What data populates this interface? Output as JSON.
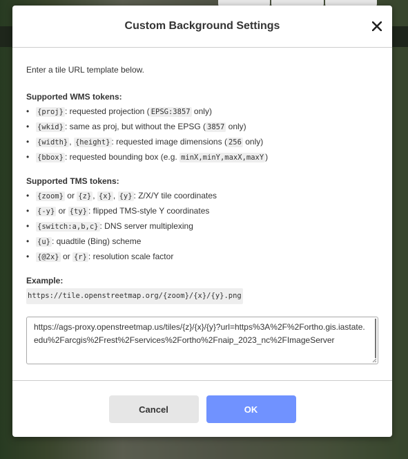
{
  "dialog": {
    "title": "Custom Background Settings",
    "close_icon": "close-icon",
    "intro": "Enter a tile URL template below.",
    "wms": {
      "title": "Supported WMS tokens:",
      "items": [
        {
          "parts": [
            {
              "code": "{proj}"
            },
            {
              "text": ": requested projection ("
            },
            {
              "code": "EPSG:3857"
            },
            {
              "text": " only)"
            }
          ]
        },
        {
          "parts": [
            {
              "code": "{wkid}"
            },
            {
              "text": ": same as proj, but without the EPSG ("
            },
            {
              "code": "3857"
            },
            {
              "text": " only)"
            }
          ]
        },
        {
          "parts": [
            {
              "code": "{width}"
            },
            {
              "text": ", "
            },
            {
              "code": "{height}"
            },
            {
              "text": ": requested image dimensions ("
            },
            {
              "code": "256"
            },
            {
              "text": " only)"
            }
          ]
        },
        {
          "parts": [
            {
              "code": "{bbox}"
            },
            {
              "text": ": requested bounding box (e.g. "
            },
            {
              "code": "minX,minY,maxX,maxY"
            },
            {
              "text": ")"
            }
          ]
        }
      ]
    },
    "tms": {
      "title": "Supported TMS tokens:",
      "items": [
        {
          "parts": [
            {
              "code": "{zoom}"
            },
            {
              "text": " or "
            },
            {
              "code": "{z}"
            },
            {
              "text": ", "
            },
            {
              "code": "{x}"
            },
            {
              "text": ", "
            },
            {
              "code": "{y}"
            },
            {
              "text": ": Z/X/Y tile coordinates"
            }
          ]
        },
        {
          "parts": [
            {
              "code": "{-y}"
            },
            {
              "text": " or "
            },
            {
              "code": "{ty}"
            },
            {
              "text": ": flipped TMS-style Y coordinates"
            }
          ]
        },
        {
          "parts": [
            {
              "code": "{switch:a,b,c}"
            },
            {
              "text": ": DNS server multiplexing"
            }
          ]
        },
        {
          "parts": [
            {
              "code": "{u}"
            },
            {
              "text": ": quadtile (Bing) scheme"
            }
          ]
        },
        {
          "parts": [
            {
              "code": "{@2x}"
            },
            {
              "text": " or "
            },
            {
              "code": "{r}"
            },
            {
              "text": ": resolution scale factor"
            }
          ]
        }
      ]
    },
    "example": {
      "title": "Example:",
      "code": "https://tile.openstreetmap.org/{zoom}/{x}/{y}.png"
    },
    "url_value": "https://ags-proxy.openstreetmap.us/tiles/{z}/{x}/{y}?url=https%3A%2F%2Fortho.gis.iastate.edu%2Farcgis%2Frest%2Fservices%2Fortho%2Fnaip_2023_nc%2FImageServer",
    "cancel_label": "Cancel",
    "ok_label": "OK",
    "ok_color": "#7092ff"
  }
}
